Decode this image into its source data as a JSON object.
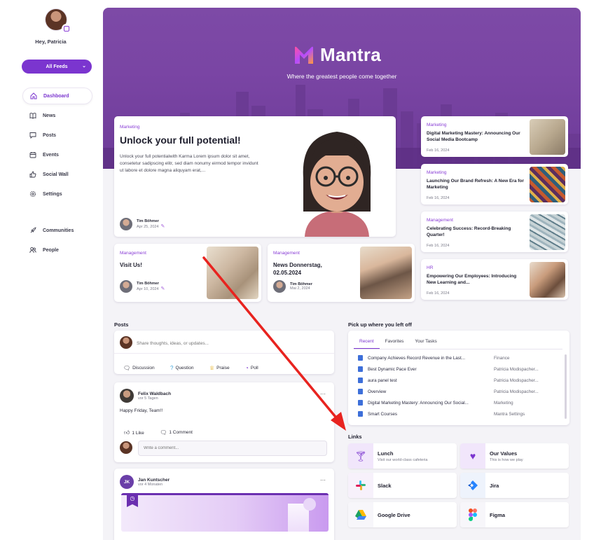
{
  "sidebar": {
    "greeting": "Hey, Patricia",
    "feeds_button": "All Feeds",
    "items": [
      {
        "label": "Dashboard",
        "icon": "home-icon"
      },
      {
        "label": "News",
        "icon": "book-icon"
      },
      {
        "label": "Posts",
        "icon": "chat-icon"
      },
      {
        "label": "Events",
        "icon": "calendar-icon"
      },
      {
        "label": "Social Wall",
        "icon": "thumbs-up-icon"
      },
      {
        "label": "Settings",
        "icon": "gear-icon"
      },
      {
        "label": "Communities",
        "icon": "rocket-icon"
      },
      {
        "label": "People",
        "icon": "people-icon"
      }
    ]
  },
  "hero": {
    "brand": "Mantra",
    "tagline": "Where the greatest people come together"
  },
  "featured": {
    "category": "Marketing",
    "title": "Unlock your full potential!",
    "excerpt": "Unlock your full potentialwith Karma Lorem ipsum dolor sit amet, consetetur sadipscing elitr, sed diam nonumy eirmod tempor invidunt ut labore et dolore magna aliquyam erat,...",
    "author": "Tim Böhmer",
    "date": "Apr 25, 2024"
  },
  "small_cards": [
    {
      "category": "Management",
      "title": "Visit Us!",
      "author": "Tim Böhmer",
      "date": "Apr 10, 2024"
    },
    {
      "category": "Management",
      "title": "News Donnerstag, 02.05.2024",
      "author": "Tim Böhmer",
      "date": "Mai 2, 2024"
    }
  ],
  "side_news": [
    {
      "category": "Marketing",
      "title": "Digital Marketing Mastery: Announcing Our Social Media Bootcamp",
      "date": "Feb 16, 2024"
    },
    {
      "category": "Marketing",
      "title": "Launching Our Brand Refresh: A New Era for Marketing",
      "date": "Feb 16, 2024"
    },
    {
      "category": "Management",
      "title": "Celebrating Success: Record-Breaking Quarter!",
      "date": "Feb 16, 2024"
    },
    {
      "category": "HR",
      "title": "Empowering Our Employees: Introducing New Learning and...",
      "date": "Feb 16, 2024"
    }
  ],
  "posts": {
    "section_title": "Posts",
    "composer_placeholder": "Share thoughts, ideas, or updates...",
    "actions": [
      "Discussion",
      "Question",
      "Praise",
      "Poll"
    ],
    "post1": {
      "author": "Felix Waldbach",
      "time": "vor 5 Tagen",
      "text": "Happy Friday, Team!!",
      "likes": "1 Like",
      "comments": "1 Comment",
      "comment_placeholder": "Write a comment..."
    },
    "post2": {
      "initials": "JK",
      "author": "Jan Kuntscher",
      "time": "vor 4 Monaten"
    }
  },
  "tasks": {
    "section_title": "Pick up where you left off",
    "tabs": [
      "Recent",
      "Favorites",
      "Your Tasks"
    ],
    "rows": [
      {
        "name": "Company Achieves Record Revenue in the Last...",
        "source": "Finance"
      },
      {
        "name": "Best Dynamic Pace Ever",
        "source": "Patricia Modispacher..."
      },
      {
        "name": "aura panel test",
        "source": "Patricia Modispacher..."
      },
      {
        "name": "Overview",
        "source": "Patricia Modispacher..."
      },
      {
        "name": "Digital Marketing Mastery: Announcing Our Social...",
        "source": "Marketing"
      },
      {
        "name": "Smart Courses",
        "source": "Mantra Settings"
      }
    ]
  },
  "links": {
    "section_title": "Links",
    "items": [
      {
        "title": "Lunch",
        "subtitle": "Visit our world-class cafeteria"
      },
      {
        "title": "Our Values",
        "subtitle": "This is how we play"
      },
      {
        "title": "Slack",
        "subtitle": ""
      },
      {
        "title": "Jira",
        "subtitle": ""
      },
      {
        "title": "Google Drive",
        "subtitle": ""
      },
      {
        "title": "Figma",
        "subtitle": ""
      }
    ]
  },
  "colors": {
    "accent": "#7b35cf",
    "hero": "#7a45a4",
    "annotation_arrow": "#e8231f"
  }
}
